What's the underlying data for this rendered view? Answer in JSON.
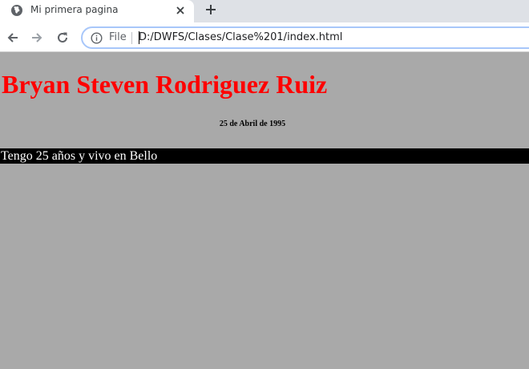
{
  "browser": {
    "tab": {
      "title": "Mi primera pagina"
    },
    "address_bar": {
      "scheme_label": "File",
      "url": "D:/DWFS/Clases/Clase%201/index.html"
    },
    "icons": {
      "tab_favicon": "globe-icon",
      "tab_close": "close-icon",
      "new_tab": "plus-icon",
      "back": "back-arrow-icon",
      "forward": "forward-arrow-icon",
      "reload": "reload-icon",
      "site_info": "info-icon"
    }
  },
  "page": {
    "background_color": "#a9a9a9",
    "heading": "Bryan Steven Rodriguez Ruiz",
    "heading_color": "#ff0000",
    "date": "25 de Abril de 1995",
    "bio": "Tengo 25 años y vivo en Bello",
    "bio_background": "#000000",
    "bio_color": "#ffffff"
  }
}
